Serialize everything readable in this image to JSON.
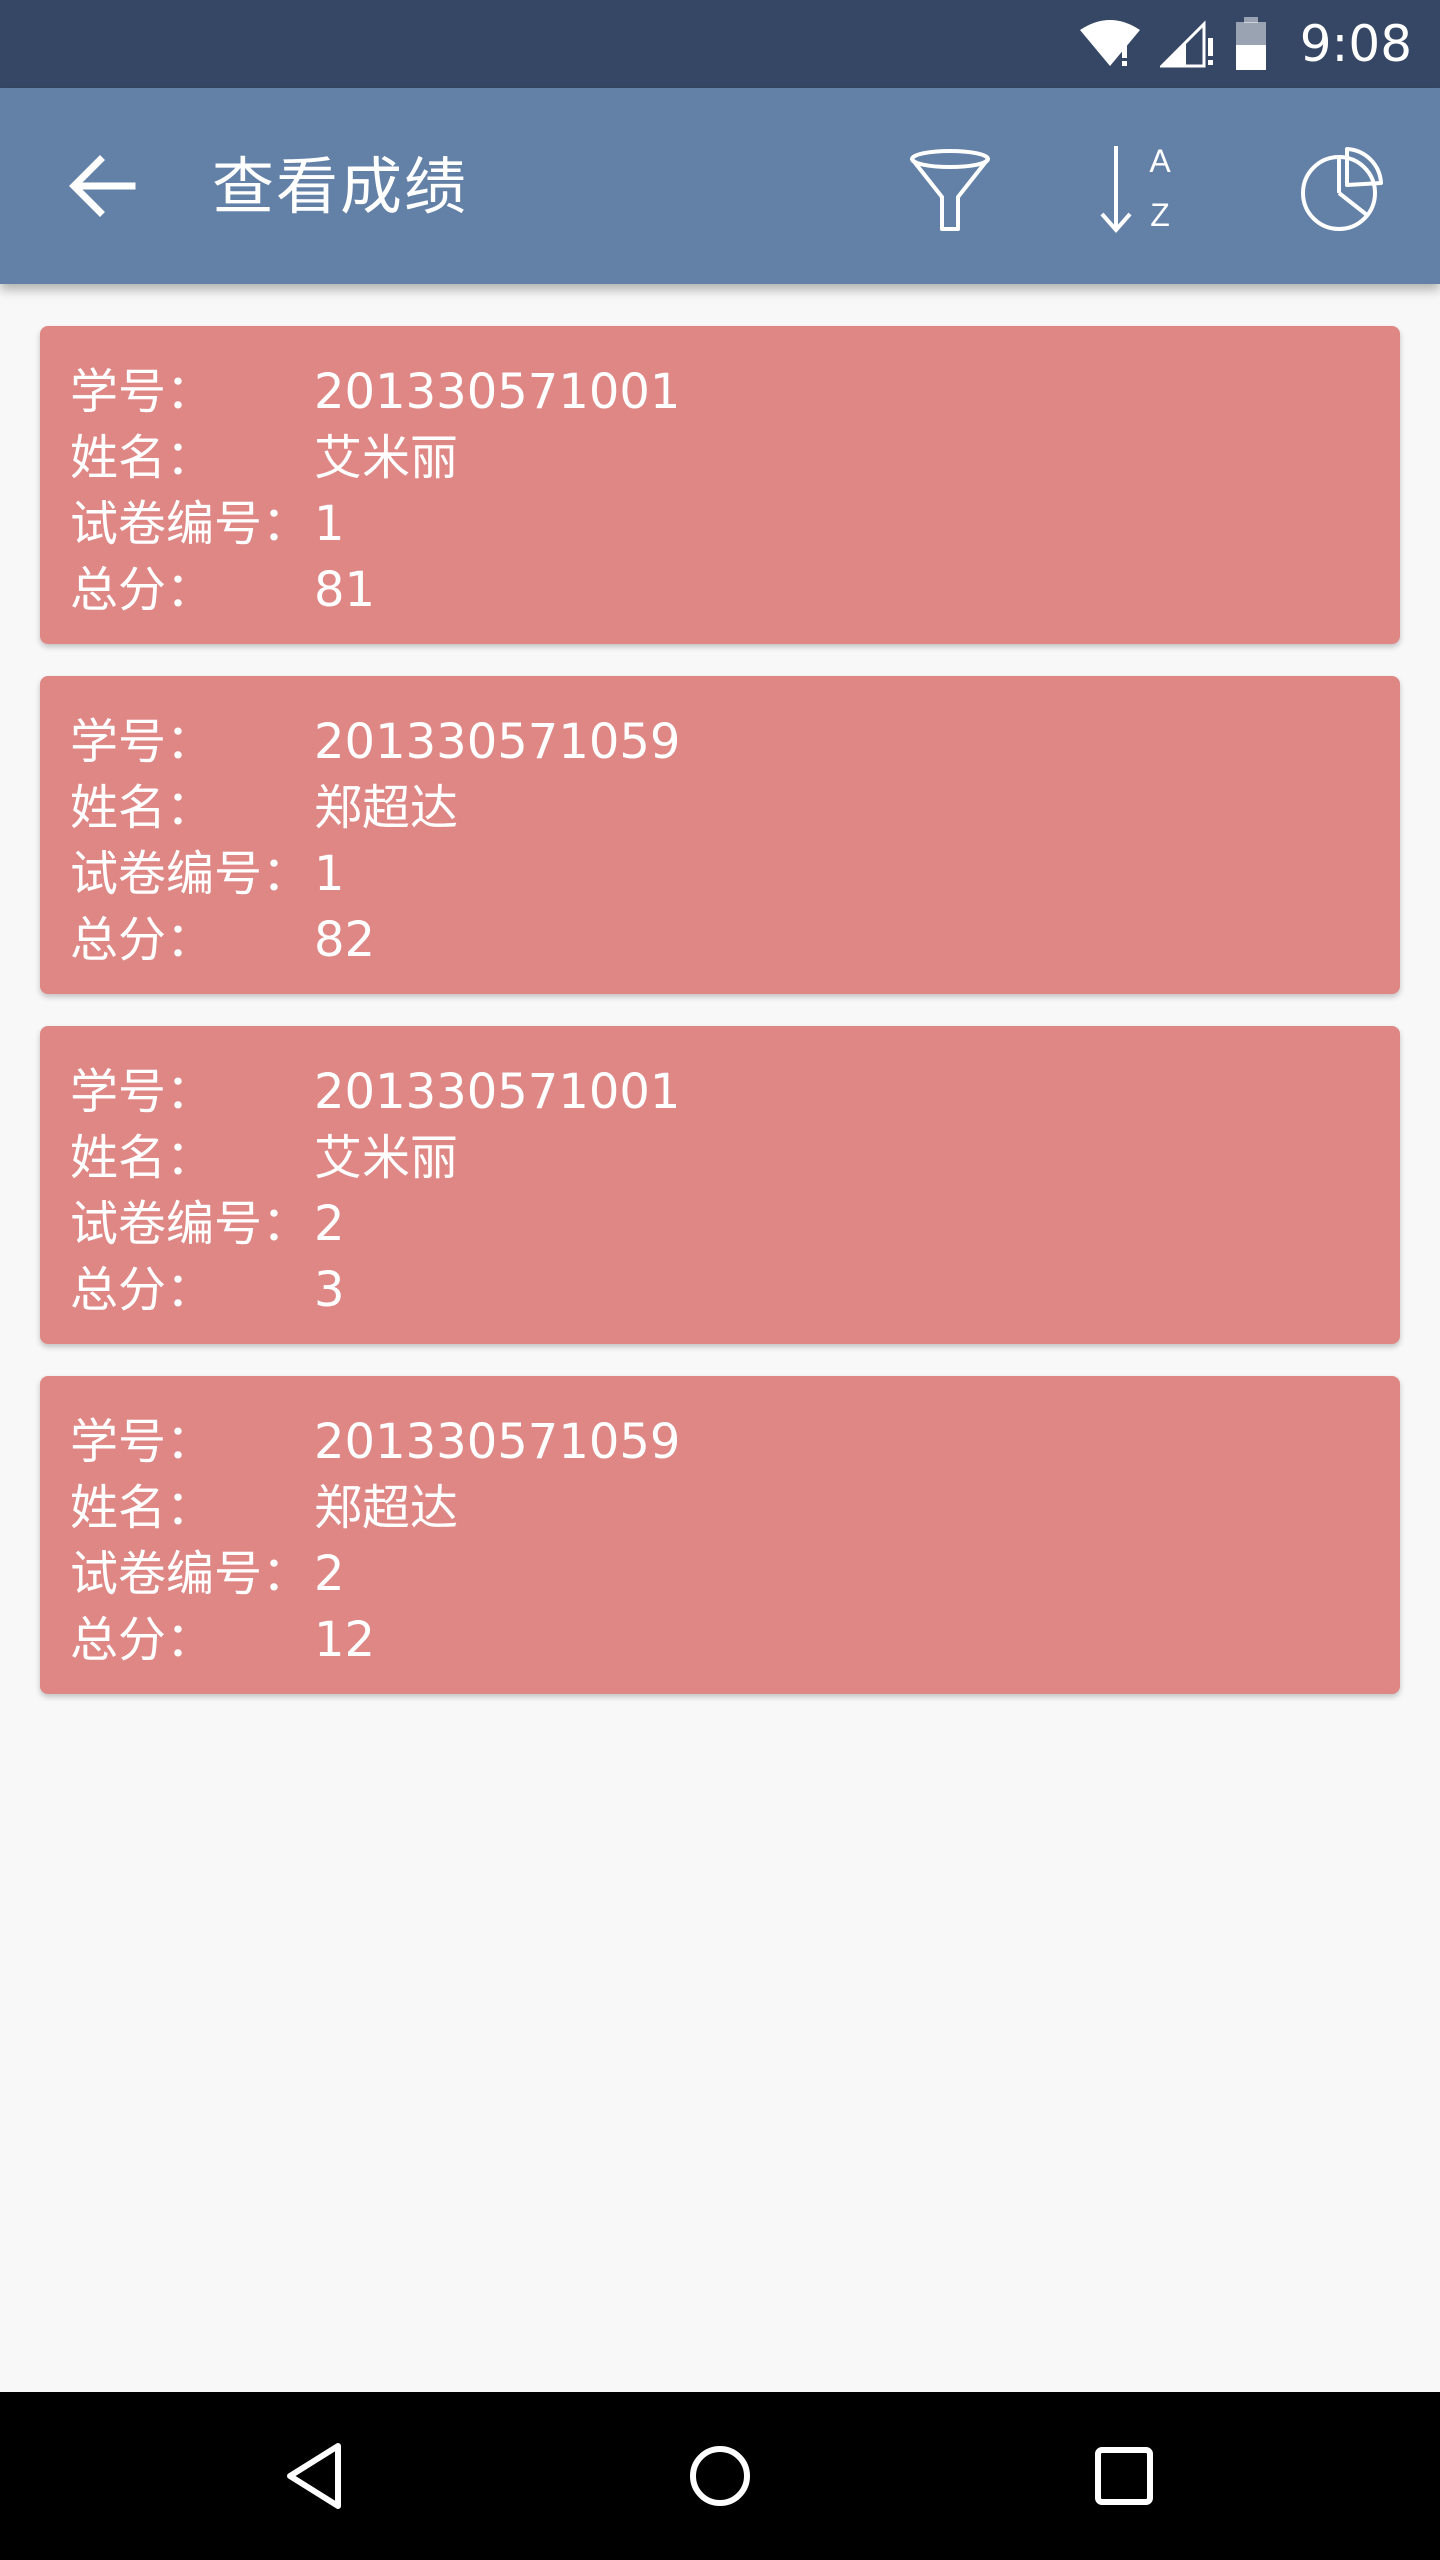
{
  "status_bar": {
    "time": "9:08",
    "icons": [
      "wifi-icon",
      "signal-icon",
      "battery-icon"
    ]
  },
  "app_bar": {
    "title": "查看成绩",
    "back_icon": "arrow-back-icon",
    "actions": [
      "filter-icon",
      "sort-az-icon",
      "pie-chart-icon"
    ]
  },
  "labels": {
    "student_id": "学号：",
    "name": "姓名：",
    "paper_no": "试卷编号：",
    "total": "总分："
  },
  "records": [
    {
      "student_id": "201330571001",
      "name": "艾米丽",
      "paper_no": "1",
      "total": "81"
    },
    {
      "student_id": "201330571059",
      "name": "郑超达",
      "paper_no": "1",
      "total": "82"
    },
    {
      "student_id": "201330571001",
      "name": "艾米丽",
      "paper_no": "2",
      "total": "3"
    },
    {
      "student_id": "201330571059",
      "name": "郑超达",
      "paper_no": "2",
      "total": "12"
    }
  ],
  "nav_bar": {
    "buttons": [
      "nav-back-icon",
      "nav-home-icon",
      "nav-recents-icon"
    ]
  },
  "colors": {
    "status_bar": "#354764",
    "app_bar": "#6381a7",
    "card": "#df8785",
    "background": "#f8f8f8"
  }
}
